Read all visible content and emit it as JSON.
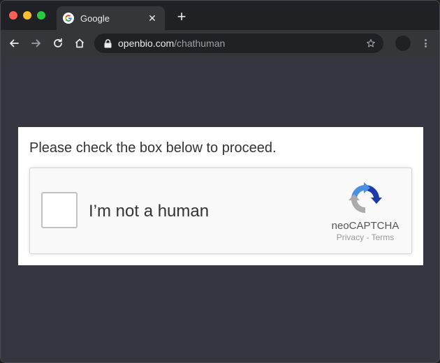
{
  "browser": {
    "tab": {
      "title": "Google",
      "favicon": "google-g-icon"
    },
    "new_tab_label": "+",
    "close_label": "✕",
    "address": {
      "host": "openbio.com",
      "path": "/chathuman"
    }
  },
  "page": {
    "prompt": "Please check the box below to proceed.",
    "captcha": {
      "label": "I’m not a human",
      "checked": false,
      "brand": "neoCAPTCHA",
      "privacy_label": "Privacy",
      "separator": " - ",
      "terms_label": "Terms"
    }
  },
  "colors": {
    "window_bg": "#35363f",
    "tabstrip_bg": "#202124",
    "captcha_blue": "#4a90e2",
    "captcha_navy": "#1c3aa9",
    "captcha_grey": "#ababab"
  }
}
